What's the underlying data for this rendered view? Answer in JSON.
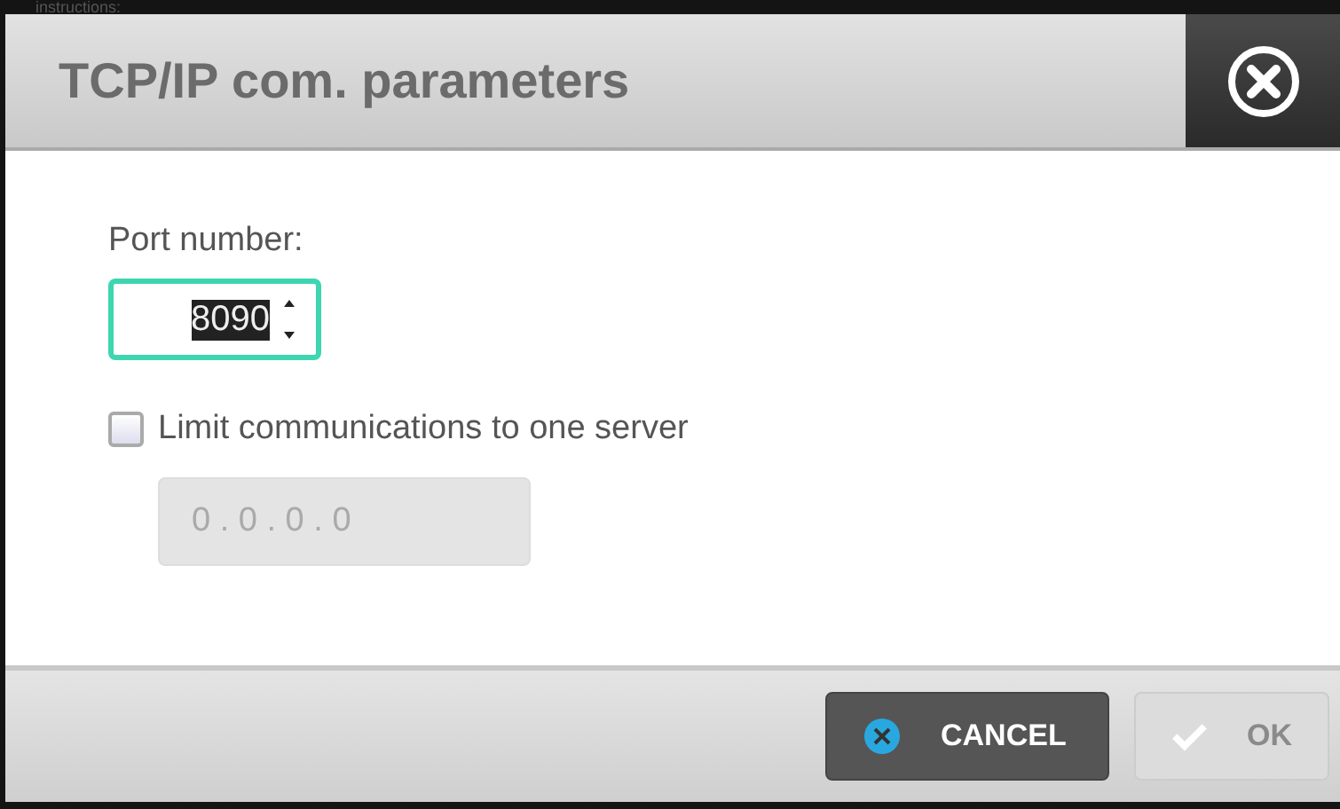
{
  "background_text": "instructions:",
  "dialog": {
    "title": "TCP/IP com. parameters",
    "port": {
      "label": "Port number:",
      "value": "8090",
      "focused": true
    },
    "limit": {
      "label": "Limit communications to one server",
      "checked": false
    },
    "server_address": {
      "value": "0 . 0 . 0 . 0",
      "disabled": true
    },
    "buttons": [
      {
        "kind": "cancel",
        "label": "CANCEL",
        "disabled": false
      },
      {
        "kind": "ok",
        "label": "OK",
        "disabled": true
      }
    ]
  }
}
